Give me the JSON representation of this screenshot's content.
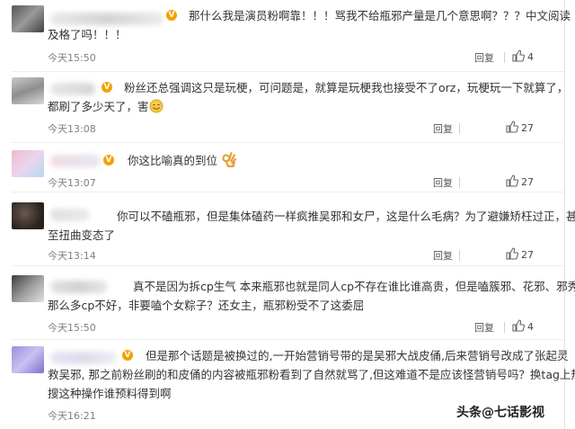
{
  "comments": [
    {
      "line1": "那什么我是演员粉啊靠！！！骂我不给瓶邪产量是几个意思啊？？？中文阅读",
      "line2": "及格了吗！！！",
      "time": "今天15:50",
      "reply_label": "回复",
      "likes": "4",
      "badge": "V",
      "badge_color": "#f4a100"
    },
    {
      "line1": "粉丝还总强调这只是玩梗，可问题是，就算是玩梗我也接受不了orz，玩梗玩一下就算了，",
      "line2": "都刷了多少天了，害",
      "time": "今天13:08",
      "reply_label": "回复",
      "likes": "27",
      "badge": "V",
      "badge_color": "#f4a100"
    },
    {
      "line1": "你这比喻真的到位",
      "time": "今天13:07",
      "reply_label": "回复",
      "likes": "27",
      "badge": "V",
      "badge_color": "#f4a100"
    },
    {
      "line1": "你可以不磕瓶邪，但是集体磕药一样疯推吴邪和女尸，这是什么毛病？为了避嫌矫枉过正，甚",
      "line2": "至扭曲变态了",
      "time": "今天13:14",
      "reply_label": "回复",
      "likes": "27"
    },
    {
      "line1": "真不是因为拆cp生气 本来瓶邪也就是同人cp不存在谁比谁高贵，但是嗑簇邪、花邪、邪秀",
      "line2": "那么多cp不好，非要嗑个女粽子？还女主，瓶邪粉受不了这委屈",
      "time": "今天15:50",
      "reply_label": "回复",
      "likes": "4"
    },
    {
      "line1": "但是那个话题是被换过的,一开始营销号带的是吴邪大战皮俑,后来营销号改成了张起灵",
      "line2": "救吴邪, 那之前粉丝刷的和皮俑的内容被瓶邪粉看到了自然就骂了,但这难道不是应该怪营销号吗？换tag上热",
      "line3": "搜这种操作谁预料得到啊",
      "time": "今天16:21",
      "badge": "V",
      "badge_color": "#f4a100"
    }
  ],
  "watermark": "头条@七话影视",
  "icons": {
    "like": "thumbs-up-icon",
    "verified": "verified-badge-icon",
    "emoji_awkward": "sweat-smile-emoji-icon",
    "emoji_ok": "ok-hand-emoji-icon"
  }
}
